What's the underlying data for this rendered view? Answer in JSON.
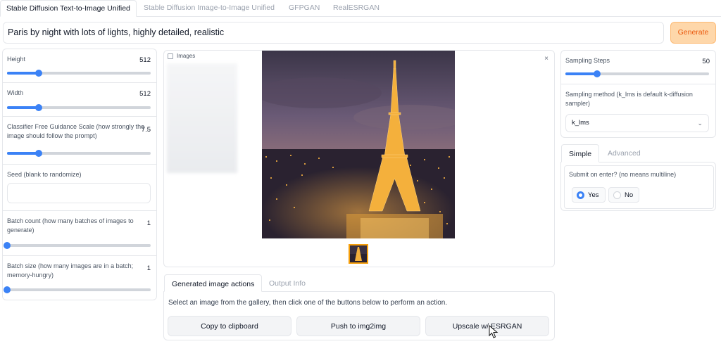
{
  "tabs": [
    {
      "label": "Stable Diffusion Text-to-Image Unified",
      "active": true
    },
    {
      "label": "Stable Diffusion Image-to-Image Unified",
      "active": false
    },
    {
      "label": "GFPGAN",
      "active": false
    },
    {
      "label": "RealESRGAN",
      "active": false
    }
  ],
  "prompt": {
    "value": "Paris by night with lots of lights, highly detailed, realistic"
  },
  "generate_button": {
    "label": "Generate"
  },
  "left": {
    "height": {
      "label": "Height",
      "value": "512",
      "fraction": 0.22
    },
    "width": {
      "label": "Width",
      "value": "512",
      "fraction": 0.22
    },
    "cfg": {
      "label_line1": "Classifier Free Guidance Scale (how strongly the",
      "label_line2": "image should follow the prompt)",
      "value": "7.5",
      "fraction": 0.22
    },
    "seed": {
      "label": "Seed (blank to randomize)",
      "value": ""
    },
    "batch_count": {
      "label_line1": "Batch count (how many batches of images to",
      "label_line2": "generate)",
      "value": "1",
      "fraction": 0.0
    },
    "batch_size": {
      "label_line1": "Batch size (how many images are in a batch;",
      "label_line2": "memory-hungry)",
      "value": "1",
      "fraction": 0.0
    }
  },
  "gallery": {
    "label": "Images",
    "close": "×"
  },
  "actions": {
    "tabs": [
      {
        "label": "Generated image actions",
        "active": true
      },
      {
        "label": "Output Info",
        "active": false
      }
    ],
    "description": "Select an image from the gallery, then click one of the buttons below to perform an action.",
    "buttons": [
      "Copy to clipboard",
      "Push to img2img",
      "Upscale w/ ESRGAN"
    ]
  },
  "right": {
    "steps": {
      "label": "Sampling Steps",
      "value": "50",
      "fraction": 0.22
    },
    "sampler": {
      "label_line1": "Sampling method (k_lms is default k-diffusion",
      "label_line2": "sampler)",
      "value": "k_lms"
    },
    "tabs": [
      {
        "label": "Simple",
        "active": true
      },
      {
        "label": "Advanced",
        "active": false
      }
    ],
    "submit": {
      "label": "Submit on enter? (no means multiline)",
      "options": [
        "Yes",
        "No"
      ],
      "selected": "Yes"
    }
  },
  "colors": {
    "accent": "#3b82f6",
    "generate_bg": "#fed7aa",
    "generate_text": "#ea580c"
  }
}
